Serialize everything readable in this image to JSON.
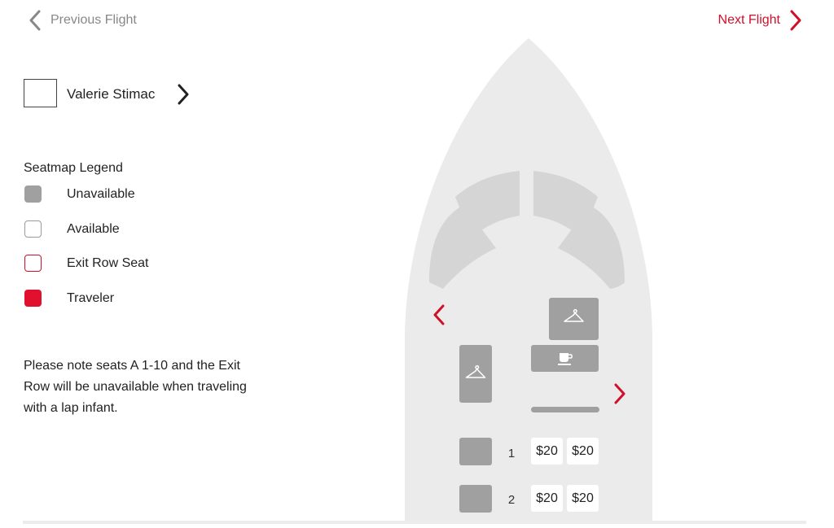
{
  "nav": {
    "prev_label": "Previous Flight",
    "next_label": "Next Flight",
    "prev_icon": "chevron-left-icon",
    "next_icon": "chevron-right-icon"
  },
  "traveler": {
    "name": "Valerie Stimac",
    "next_icon": "chevron-right-icon"
  },
  "legend": {
    "title": "Seatmap Legend",
    "items": [
      {
        "label": "Unavailable",
        "color": "#a0a0a0",
        "style": "filled-gray"
      },
      {
        "label": "Available",
        "color": "#ffffff",
        "style": "outline-gray"
      },
      {
        "label": "Exit Row Seat",
        "color": "#d0102a",
        "style": "outline-red"
      },
      {
        "label": "Traveler",
        "color": "#e0102e",
        "style": "filled-red"
      }
    ]
  },
  "note": "Please note seats A 1-10 and the Exit Row will be unavailable when traveling with a lap infant.",
  "seatmap": {
    "scroll_left_icon": "chevron-left-icon",
    "scroll_right_icon": "chevron-right-icon",
    "amenities": [
      "closet-hanger-icon",
      "galley-coffee-icon",
      "closet-hanger-icon"
    ],
    "rows": [
      {
        "number": "1",
        "left_seat": "unavailable",
        "right_seats": [
          "$20",
          "$20"
        ]
      },
      {
        "number": "2",
        "left_seat": "unavailable",
        "right_seats": [
          "$20",
          "$20"
        ]
      }
    ]
  },
  "colors": {
    "accent": "#d0102a",
    "fuselage": "#ebebeb",
    "cockpit": "#d5d5d5",
    "unavailable": "#a0a0a0"
  }
}
